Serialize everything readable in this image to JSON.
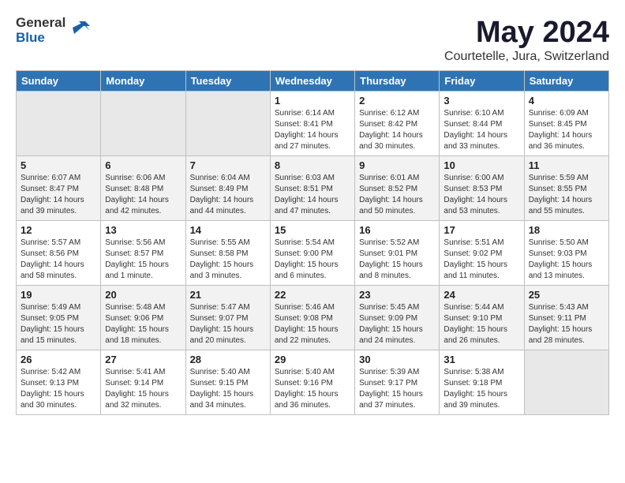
{
  "header": {
    "logo_general": "General",
    "logo_blue": "Blue",
    "title": "May 2024",
    "subtitle": "Courtetelle, Jura, Switzerland"
  },
  "weekdays": [
    "Sunday",
    "Monday",
    "Tuesday",
    "Wednesday",
    "Thursday",
    "Friday",
    "Saturday"
  ],
  "weeks": [
    [
      {
        "day": "",
        "info": ""
      },
      {
        "day": "",
        "info": ""
      },
      {
        "day": "",
        "info": ""
      },
      {
        "day": "1",
        "info": "Sunrise: 6:14 AM\nSunset: 8:41 PM\nDaylight: 14 hours\nand 27 minutes."
      },
      {
        "day": "2",
        "info": "Sunrise: 6:12 AM\nSunset: 8:42 PM\nDaylight: 14 hours\nand 30 minutes."
      },
      {
        "day": "3",
        "info": "Sunrise: 6:10 AM\nSunset: 8:44 PM\nDaylight: 14 hours\nand 33 minutes."
      },
      {
        "day": "4",
        "info": "Sunrise: 6:09 AM\nSunset: 8:45 PM\nDaylight: 14 hours\nand 36 minutes."
      }
    ],
    [
      {
        "day": "5",
        "info": "Sunrise: 6:07 AM\nSunset: 8:47 PM\nDaylight: 14 hours\nand 39 minutes."
      },
      {
        "day": "6",
        "info": "Sunrise: 6:06 AM\nSunset: 8:48 PM\nDaylight: 14 hours\nand 42 minutes."
      },
      {
        "day": "7",
        "info": "Sunrise: 6:04 AM\nSunset: 8:49 PM\nDaylight: 14 hours\nand 44 minutes."
      },
      {
        "day": "8",
        "info": "Sunrise: 6:03 AM\nSunset: 8:51 PM\nDaylight: 14 hours\nand 47 minutes."
      },
      {
        "day": "9",
        "info": "Sunrise: 6:01 AM\nSunset: 8:52 PM\nDaylight: 14 hours\nand 50 minutes."
      },
      {
        "day": "10",
        "info": "Sunrise: 6:00 AM\nSunset: 8:53 PM\nDaylight: 14 hours\nand 53 minutes."
      },
      {
        "day": "11",
        "info": "Sunrise: 5:59 AM\nSunset: 8:55 PM\nDaylight: 14 hours\nand 55 minutes."
      }
    ],
    [
      {
        "day": "12",
        "info": "Sunrise: 5:57 AM\nSunset: 8:56 PM\nDaylight: 14 hours\nand 58 minutes."
      },
      {
        "day": "13",
        "info": "Sunrise: 5:56 AM\nSunset: 8:57 PM\nDaylight: 15 hours\nand 1 minute."
      },
      {
        "day": "14",
        "info": "Sunrise: 5:55 AM\nSunset: 8:58 PM\nDaylight: 15 hours\nand 3 minutes."
      },
      {
        "day": "15",
        "info": "Sunrise: 5:54 AM\nSunset: 9:00 PM\nDaylight: 15 hours\nand 6 minutes."
      },
      {
        "day": "16",
        "info": "Sunrise: 5:52 AM\nSunset: 9:01 PM\nDaylight: 15 hours\nand 8 minutes."
      },
      {
        "day": "17",
        "info": "Sunrise: 5:51 AM\nSunset: 9:02 PM\nDaylight: 15 hours\nand 11 minutes."
      },
      {
        "day": "18",
        "info": "Sunrise: 5:50 AM\nSunset: 9:03 PM\nDaylight: 15 hours\nand 13 minutes."
      }
    ],
    [
      {
        "day": "19",
        "info": "Sunrise: 5:49 AM\nSunset: 9:05 PM\nDaylight: 15 hours\nand 15 minutes."
      },
      {
        "day": "20",
        "info": "Sunrise: 5:48 AM\nSunset: 9:06 PM\nDaylight: 15 hours\nand 18 minutes."
      },
      {
        "day": "21",
        "info": "Sunrise: 5:47 AM\nSunset: 9:07 PM\nDaylight: 15 hours\nand 20 minutes."
      },
      {
        "day": "22",
        "info": "Sunrise: 5:46 AM\nSunset: 9:08 PM\nDaylight: 15 hours\nand 22 minutes."
      },
      {
        "day": "23",
        "info": "Sunrise: 5:45 AM\nSunset: 9:09 PM\nDaylight: 15 hours\nand 24 minutes."
      },
      {
        "day": "24",
        "info": "Sunrise: 5:44 AM\nSunset: 9:10 PM\nDaylight: 15 hours\nand 26 minutes."
      },
      {
        "day": "25",
        "info": "Sunrise: 5:43 AM\nSunset: 9:11 PM\nDaylight: 15 hours\nand 28 minutes."
      }
    ],
    [
      {
        "day": "26",
        "info": "Sunrise: 5:42 AM\nSunset: 9:13 PM\nDaylight: 15 hours\nand 30 minutes."
      },
      {
        "day": "27",
        "info": "Sunrise: 5:41 AM\nSunset: 9:14 PM\nDaylight: 15 hours\nand 32 minutes."
      },
      {
        "day": "28",
        "info": "Sunrise: 5:40 AM\nSunset: 9:15 PM\nDaylight: 15 hours\nand 34 minutes."
      },
      {
        "day": "29",
        "info": "Sunrise: 5:40 AM\nSunset: 9:16 PM\nDaylight: 15 hours\nand 36 minutes."
      },
      {
        "day": "30",
        "info": "Sunrise: 5:39 AM\nSunset: 9:17 PM\nDaylight: 15 hours\nand 37 minutes."
      },
      {
        "day": "31",
        "info": "Sunrise: 5:38 AM\nSunset: 9:18 PM\nDaylight: 15 hours\nand 39 minutes."
      },
      {
        "day": "",
        "info": ""
      }
    ]
  ]
}
